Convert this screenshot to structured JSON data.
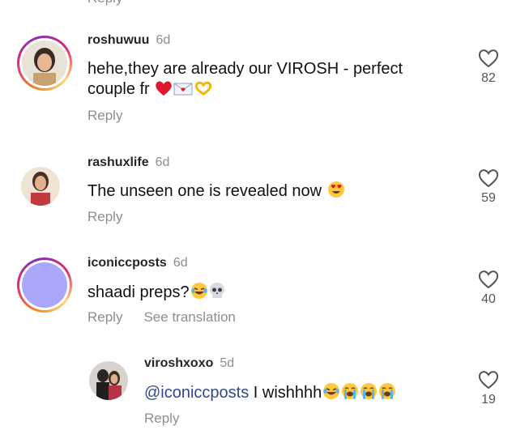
{
  "top_reply_label": "Reply",
  "comments": [
    {
      "username": "roshuwuu",
      "time": "6d",
      "text": "hehe,they are already our VIROSH - perfect couple fr",
      "emoji": [
        "heart",
        "love-letter",
        "heart-hands"
      ],
      "actions": [
        "Reply"
      ],
      "likes": "82"
    },
    {
      "username": "rashuxlife",
      "time": "6d",
      "text": "The unseen one is revealed now",
      "emoji": [
        "heart-eyes"
      ],
      "actions": [
        "Reply"
      ],
      "likes": "59"
    },
    {
      "username": "iconiccposts",
      "time": "6d",
      "text": "shaadi preps?",
      "emoji": [
        "laughing",
        "skull"
      ],
      "actions": [
        "Reply",
        "See translation"
      ],
      "likes": "40"
    },
    {
      "username": "viroshxoxo",
      "time": "5d",
      "mention": "@iconiccposts",
      "text": " I wishhhh",
      "emoji": [
        "laughing",
        "crying",
        "crying",
        "crying"
      ],
      "actions": [
        "Reply"
      ],
      "likes": "19"
    }
  ],
  "colors": {
    "secondary_text": "#8e8e8e",
    "mention": "#2f4a8a",
    "ring_gradient": [
      "#f58529",
      "#dd2a7b",
      "#8134af",
      "#feda75"
    ],
    "placeholder_avatar": "#aaa6f9"
  }
}
